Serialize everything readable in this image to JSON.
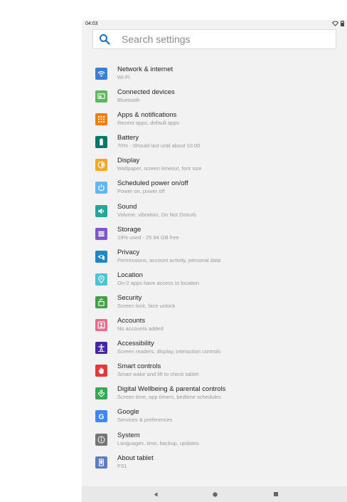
{
  "status": {
    "time": "04:03"
  },
  "search": {
    "placeholder": "Search settings"
  },
  "items": [
    {
      "title": "Network & internet",
      "subtitle": "Wi-Fi",
      "color": "#3b7fd4",
      "icon": "wifi-icon"
    },
    {
      "title": "Connected devices",
      "subtitle": "Bluetooth",
      "color": "#5cb85c",
      "icon": "devices-icon"
    },
    {
      "title": "Apps & notifications",
      "subtitle": "Recent apps, default apps",
      "color": "#f57c00",
      "icon": "apps-icon"
    },
    {
      "title": "Battery",
      "subtitle": "70% - Should last until about 10:00",
      "color": "#00796b",
      "icon": "battery-icon"
    },
    {
      "title": "Display",
      "subtitle": "Wallpaper, screen timeout, font size",
      "color": "#f5a623",
      "icon": "brightness-icon"
    },
    {
      "title": "Scheduled power on/off",
      "subtitle": "Power on, power off",
      "color": "#64b5f6",
      "icon": "power-icon"
    },
    {
      "title": "Sound",
      "subtitle": "Volume, vibration, Do Not Disturb",
      "color": "#26a69a",
      "icon": "volume-icon"
    },
    {
      "title": "Storage",
      "subtitle": "19% used - 25.94 GB free",
      "color": "#7e57c2",
      "icon": "storage-icon"
    },
    {
      "title": "Privacy",
      "subtitle": "Permissions, account activity, personal data",
      "color": "#1e88c5",
      "icon": "privacy-icon"
    },
    {
      "title": "Location",
      "subtitle": "On-2 apps have access to location",
      "color": "#4dc3d4",
      "icon": "location-icon"
    },
    {
      "title": "Security",
      "subtitle": "Screen lock, face unlock",
      "color": "#43a047",
      "icon": "lock-icon"
    },
    {
      "title": "Accounts",
      "subtitle": "No accounts added",
      "color": "#ec6a8c",
      "icon": "account-icon"
    },
    {
      "title": "Accessibility",
      "subtitle": "Screen readers, display, interaction controls",
      "color": "#4527a0",
      "icon": "accessibility-icon"
    },
    {
      "title": "Smart controls",
      "subtitle": "Smart wake and lift to check tablet",
      "color": "#e53935",
      "icon": "hand-icon"
    },
    {
      "title": "Digital Wellbeing & parental controls",
      "subtitle": "Screen time, app timers, bedtime schedules",
      "color": "#34a853",
      "icon": "wellbeing-icon"
    },
    {
      "title": "Google",
      "subtitle": "Services & preferences",
      "color": "#4285f4",
      "icon": "google-icon"
    },
    {
      "title": "System",
      "subtitle": "Languages, time, backup, updates",
      "color": "#757575",
      "icon": "info-icon"
    },
    {
      "title": "About tablet",
      "subtitle": "P31",
      "color": "#5c7cc4",
      "icon": "tablet-icon"
    }
  ],
  "nav": {
    "back": "back-icon",
    "home": "home-icon",
    "recents": "recents-icon"
  }
}
